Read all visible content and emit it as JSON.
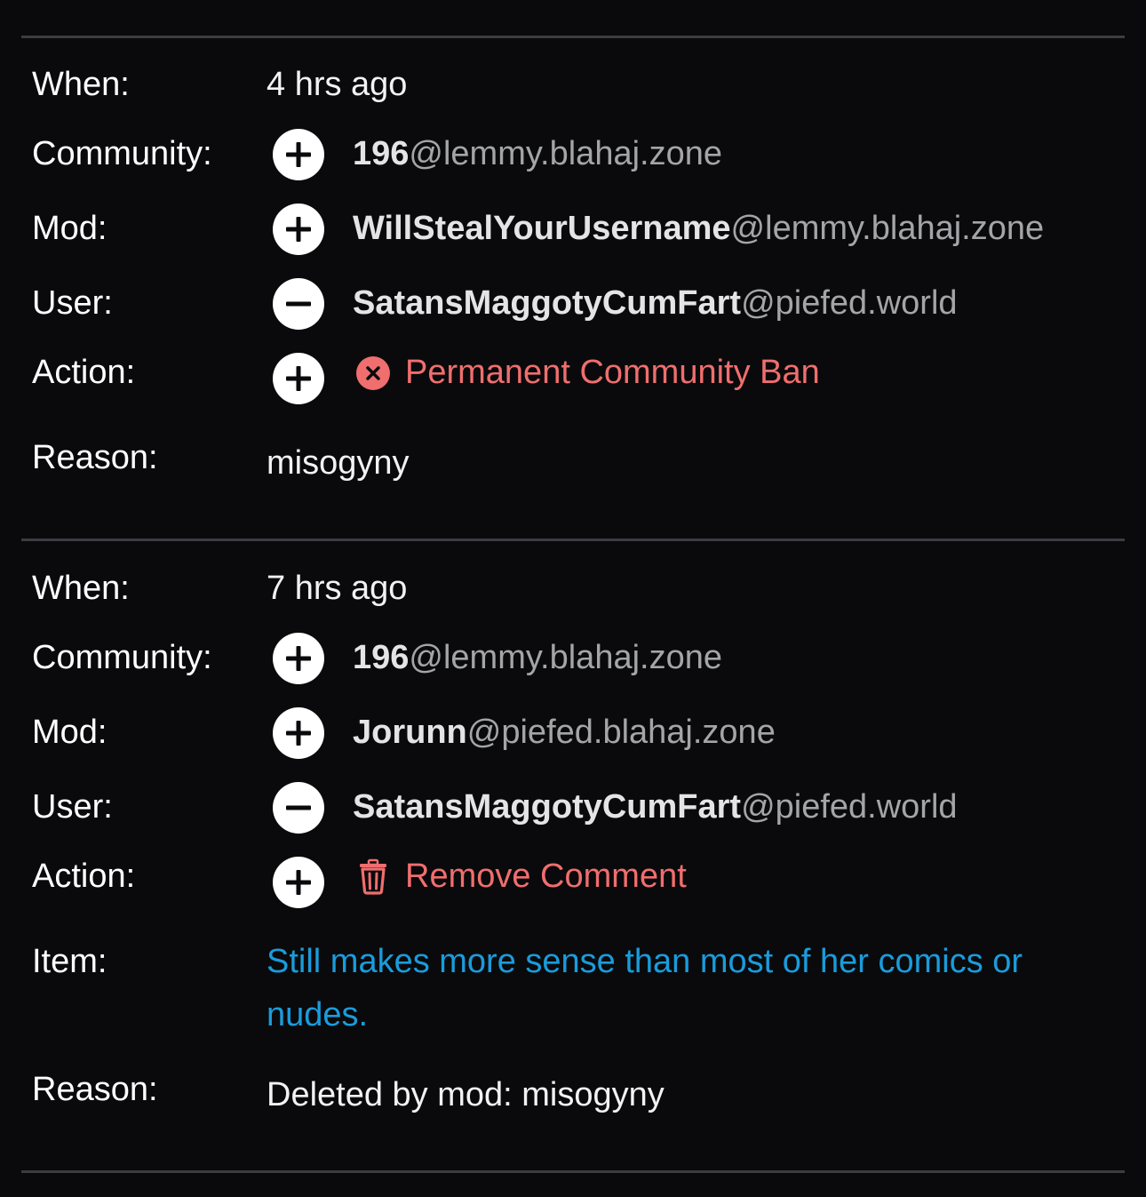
{
  "labels": {
    "when": "When:",
    "community": "Community:",
    "mod": "Mod:",
    "user": "User:",
    "action": "Action:",
    "reason": "Reason:",
    "item": "Item:"
  },
  "entries": [
    {
      "when": "4 hrs ago",
      "community": {
        "name": "196",
        "host": "@lemmy.blahaj.zone",
        "toggle_icon": "plus-icon"
      },
      "mod": {
        "name": "WillStealYourUsername",
        "host": "@lemmy.blahaj.zone",
        "toggle_icon": "plus-icon"
      },
      "user": {
        "name": "SatansMaggotyCumFart",
        "host": "@piefed.world",
        "toggle_icon": "minus-icon"
      },
      "action": {
        "label": "Permanent Community Ban",
        "icon": "ban-x-icon",
        "toggle_icon": "plus-icon"
      },
      "reason": "misogyny"
    },
    {
      "when": "7 hrs ago",
      "community": {
        "name": "196",
        "host": "@lemmy.blahaj.zone",
        "toggle_icon": "plus-icon"
      },
      "mod": {
        "name": "Jorunn",
        "host": "@piefed.blahaj.zone",
        "toggle_icon": "plus-icon"
      },
      "user": {
        "name": "SatansMaggotyCumFart",
        "host": "@piefed.world",
        "toggle_icon": "minus-icon"
      },
      "action": {
        "label": "Remove Comment",
        "icon": "trash-icon",
        "toggle_icon": "plus-icon"
      },
      "item": "Still makes more sense than most of her comics or nudes.",
      "reason": "Deleted by mod: misogyny"
    }
  ],
  "colors": {
    "background": "#0a0a0c",
    "action_red": "#f06e6e",
    "link_blue": "#1a9cdc",
    "divider": "#3b3d42"
  }
}
